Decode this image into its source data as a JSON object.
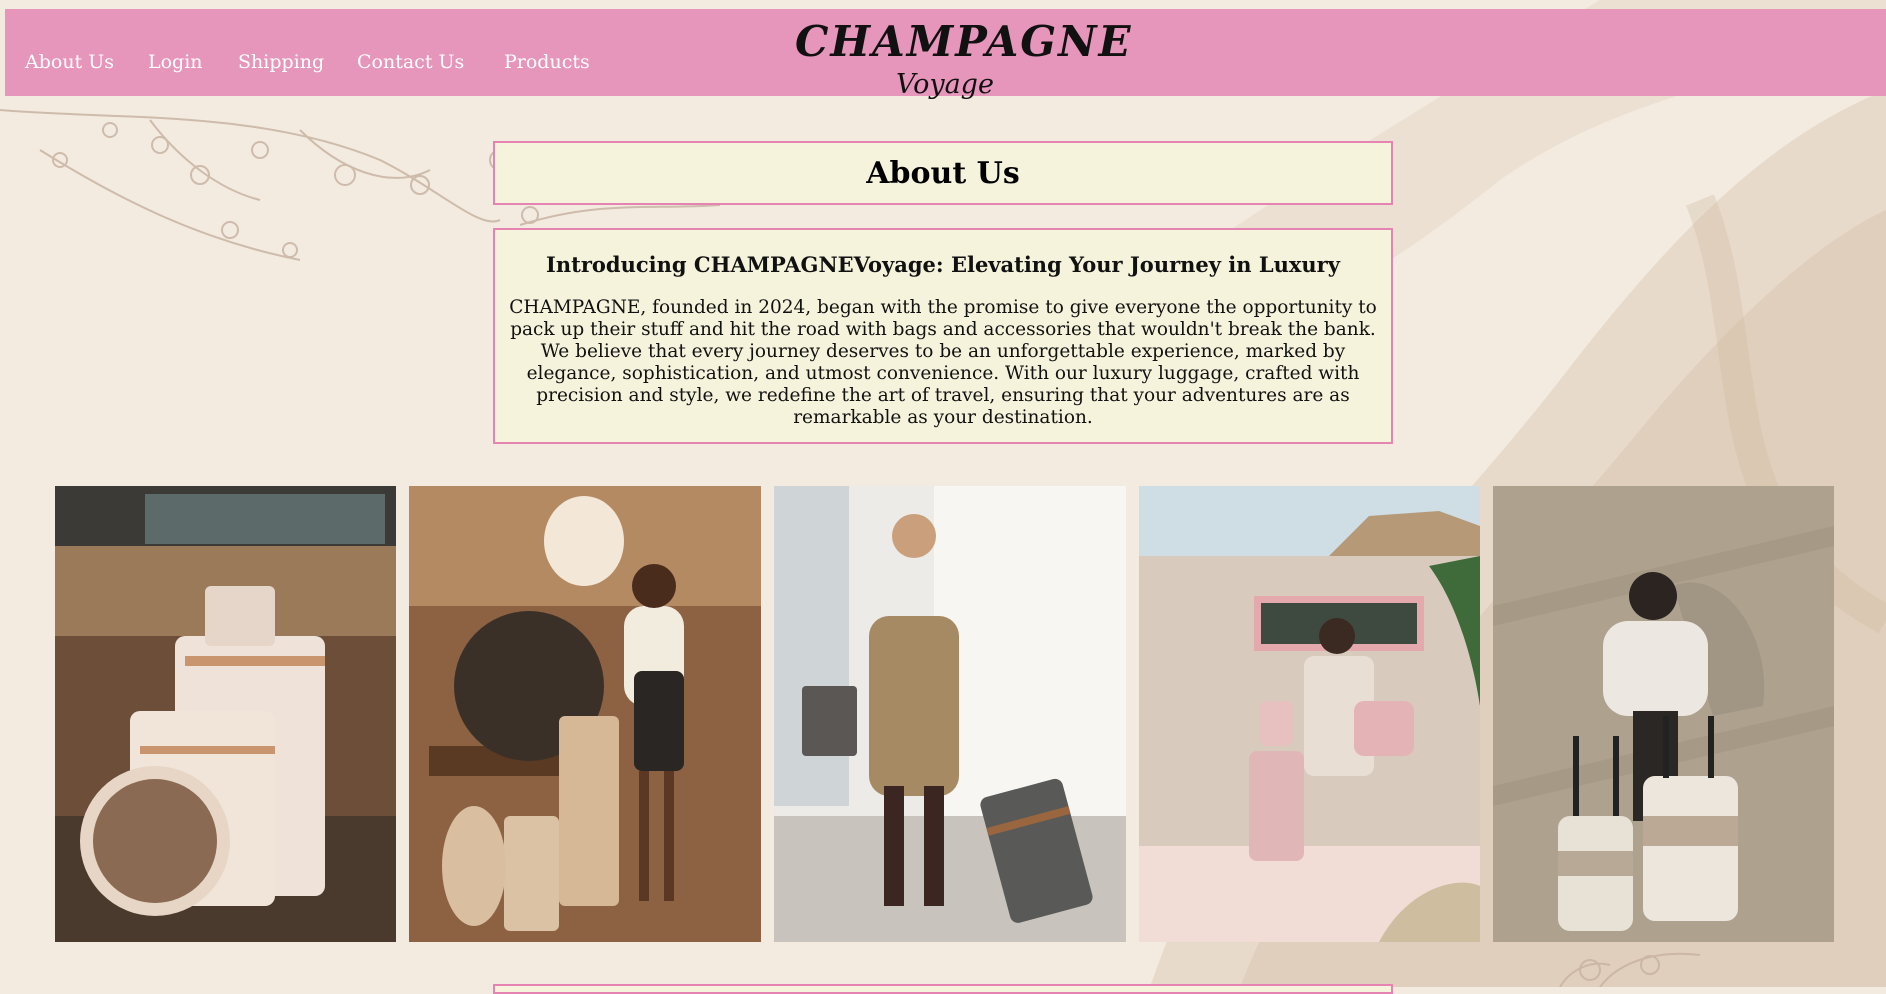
{
  "nav": {
    "links": [
      "About Us",
      "Login",
      "Shipping",
      "Contact Us",
      "Products"
    ]
  },
  "logo": {
    "main": "CHAMPAGNE",
    "sub": "Voyage"
  },
  "about": {
    "title": "About Us",
    "heading": "Introducing CHAMPAGNEVoyage: Elevating Your Journey in Luxury",
    "body": "CHAMPAGNE, founded in 2024, began with the promise to give everyone the opportunity to pack up their stuff and hit the road with bags and accessories that wouldn't break the bank. We believe that every journey deserves to be an unforgettable experience, marked by elegance, sophistication, and utmost convenience. With our luxury luggage, crafted with precision and style, we redefine the art of travel, ensuring that your adventures are as remarkable as your destination."
  },
  "colors": {
    "nav_bg": "#e796bb",
    "box_bg": "#f5f3dc",
    "box_border": "#e583b3",
    "page_bg": "#f3ebe0"
  },
  "gallery": [
    "luggage-set-photo",
    "woman-with-luggage-photo",
    "man-with-suitcase-photo",
    "woman-pink-luggage-photo",
    "woman-white-suitcases-photo"
  ]
}
